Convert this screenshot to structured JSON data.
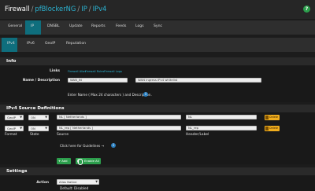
{
  "breadcrumb": {
    "root": "Firewall",
    "item1": "pfBlockerNG",
    "item2": "IP",
    "item3": "IPv4",
    "sep": "/"
  },
  "help_glyph": "?",
  "main_tabs": [
    {
      "label": "General"
    },
    {
      "label": "IP"
    },
    {
      "label": "DNSBL"
    },
    {
      "label": "Update"
    },
    {
      "label": "Reports"
    },
    {
      "label": "Feeds"
    },
    {
      "label": "Logs"
    },
    {
      "label": "Sync"
    }
  ],
  "sub_tabs": [
    {
      "label": "IPv4"
    },
    {
      "label": "IPv6"
    },
    {
      "label": "GeoIP"
    },
    {
      "label": "Reputation"
    }
  ],
  "info": {
    "title": "Info",
    "links_label": "Links",
    "links": [
      "Firewall Alias",
      "Firewall Rules",
      "Firewall Logs"
    ],
    "name_label": "Name / Description",
    "name_value": "WAN_IN",
    "desc_value": "WAN ingress IPv4 whitelist",
    "hint": "Enter Name ( Max 24 characters ) and Description."
  },
  "source": {
    "title": "IPv4 Source Definitions",
    "rows": [
      {
        "format": "GeoIP",
        "state": "ON",
        "source": "NL [ Netherlands ]",
        "header": "NL",
        "delete": "Delete"
      },
      {
        "format": "GeoIP",
        "state": "ON",
        "source": "NL_rep [ Netherlands ]",
        "header": "NL_rep",
        "delete": "Delete"
      }
    ],
    "col_format": "Format",
    "col_state": "State",
    "col_source": "Source",
    "col_header": "Header/Label",
    "guidelines": "Click here for Guidelines →",
    "add_label": "Add",
    "enable_all_label": "Enable All"
  },
  "settings": {
    "title": "Settings",
    "action_label": "Action",
    "action_value": "Alias Native",
    "default_text": "Default: Disabled"
  },
  "colors": {
    "accent": "#0f6e7d",
    "link": "#2bb4d3",
    "green": "#2c9e4c",
    "warning": "#f0ad1d"
  },
  "icons": {
    "chevron": "chevron-down-icon",
    "info": "info-icon",
    "trash": "trash-icon"
  }
}
